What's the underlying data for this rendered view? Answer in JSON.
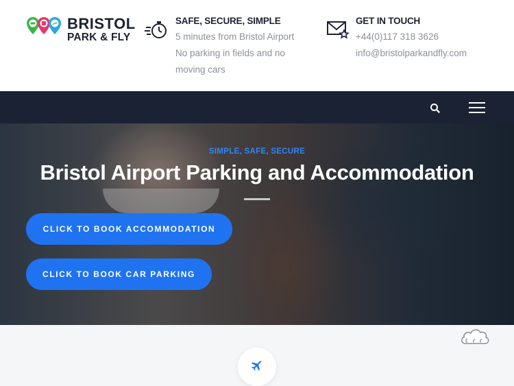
{
  "header": {
    "logo": {
      "line1": "BRISTOL",
      "line2": "PARK & FLY",
      "colors": {
        "green": "#3ab54a",
        "pink": "#e6366b",
        "blue": "#29a9df"
      }
    },
    "info1": {
      "icon": "stopwatch-icon",
      "title": "SAFE, SECURE, SIMPLE",
      "lines": [
        "5 minutes from Bristol Airport",
        "No parking in fields and no",
        "moving cars"
      ]
    },
    "info2": {
      "icon": "envelope-star-icon",
      "title": "GET IN TOUCH",
      "lines": [
        "+44(0)117 318 3626",
        "info@bristolparkandfly.com"
      ]
    }
  },
  "nav": {
    "search_icon": "search-icon",
    "menu_icon": "hamburger-menu-icon",
    "background": "#1b2234"
  },
  "hero": {
    "kicker": "SIMPLE, SAFE, SECURE",
    "title": "Bristol Airport Parking and Accommodation",
    "buttons": [
      {
        "label": "CLICK TO BOOK ACCOMMODATION"
      },
      {
        "label": "CLICK TO BOOK CAR PARKING"
      }
    ],
    "accent": "#1f73f1"
  },
  "lower": {
    "icons": [
      "cloud-icon",
      "airplane-icon"
    ]
  }
}
